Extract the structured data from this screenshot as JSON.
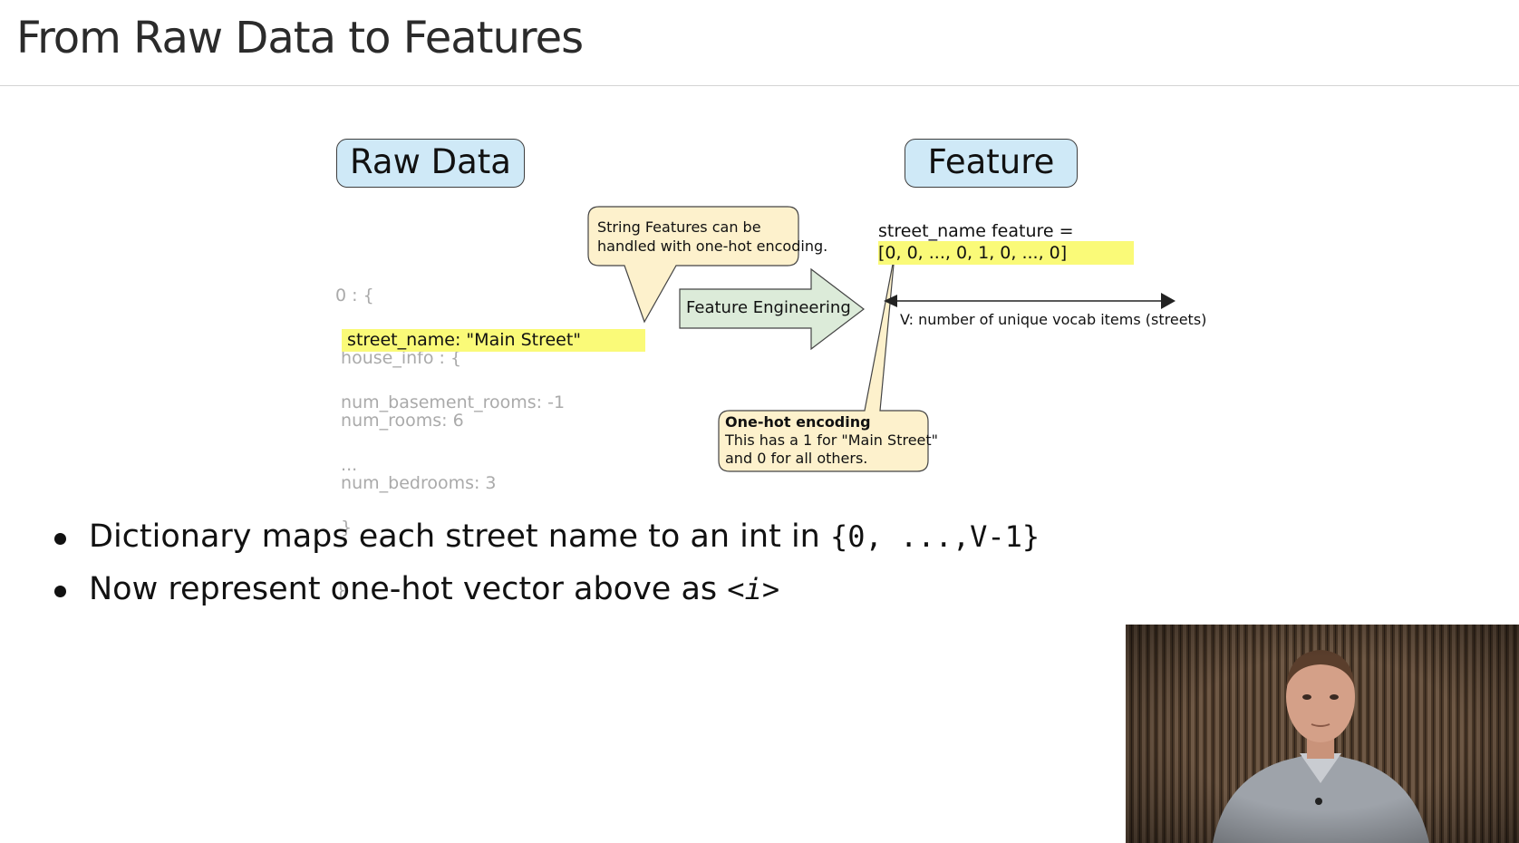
{
  "slide": {
    "title": "From Raw Data to Features"
  },
  "diagram": {
    "raw_label": "Raw Data",
    "feature_label": "Feature",
    "raw_code": {
      "lines": [
        "0 : {",
        " house_info : {",
        " num_rooms: 6",
        " num_bedrooms: 3"
      ],
      "highlight": " street_name: \"Main Street\"",
      "tail": [
        " num_basement_rooms: -1",
        " ...",
        " }",
        "}"
      ]
    },
    "callout_string": {
      "line1": "String Features can be",
      "line2": "handled with one-hot encoding."
    },
    "arrow_label": "Feature Engineering",
    "feature_vector": {
      "label": "street_name feature =",
      "value": "[0, 0, ..., 0, 1, 0, ..., 0]"
    },
    "v_label": "V: number of unique vocab items (streets)",
    "callout_onehot": {
      "title": "One-hot encoding",
      "line1": "This has a 1 for \"Main Street\"",
      "line2": "and 0 for all others."
    }
  },
  "bullets": [
    {
      "text": "Dictionary maps each street name to an int in ",
      "code": "{0, ...,V-1}"
    },
    {
      "text": "Now represent one-hot vector above as ",
      "code_open": "<",
      "code_var": "i",
      "code_close": ">"
    }
  ],
  "colors": {
    "pill_fill": "#cfe9f7",
    "highlight": "#fafa78",
    "callout_fill": "#fdf1cc",
    "arrow_fill": "#dcebd9"
  }
}
